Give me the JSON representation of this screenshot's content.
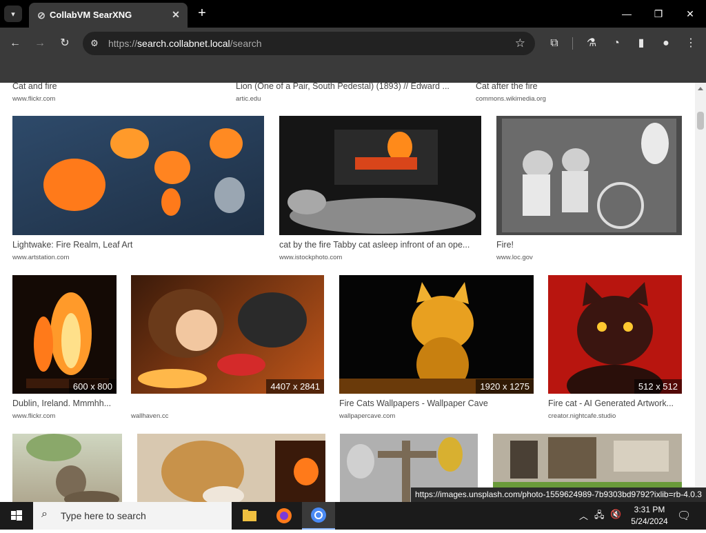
{
  "browser": {
    "tab_title": "CollabVM SearXNG",
    "url_scheme": "https://",
    "url_host": "search.collabnet.local",
    "url_path": "/search",
    "status_url": "https://images.unsplash.com/photo-1559624989-7b9303bd9792?ixlib=rb-4.0.3"
  },
  "results": [
    {
      "title": "Cat and fire",
      "source": "www.flickr.com"
    },
    {
      "title": "Lion (One of a Pair, South Pedestal) (1893) // Edward ...",
      "source": "artic.edu"
    },
    {
      "title": "Cat after the fire",
      "source": "commons.wikimedia.org"
    },
    {
      "title": "Lightwake: Fire Realm, Leaf Art",
      "source": "www.artstation.com"
    },
    {
      "title": "cat by the fire Tabby cat asleep infront of an ope...",
      "source": "www.istockphoto.com"
    },
    {
      "title": "Fire!",
      "source": "www.loc.gov"
    },
    {
      "title": "Dublin, Ireland. Mmmhh...",
      "source": "www.flickr.com",
      "dimensions": "600 x 800"
    },
    {
      "title": "",
      "source": "wallhaven.cc",
      "dimensions": "4407 x 2841"
    },
    {
      "title": "Fire Cats Wallpapers - Wallpaper Cave",
      "source": "wallpapercave.com",
      "dimensions": "1920 x 1275"
    },
    {
      "title": "Fire cat - AI Generated Artwork...",
      "source": "creator.nightcafe.studio",
      "dimensions": "512 x 512"
    }
  ],
  "taskbar": {
    "search_placeholder": "Type here to search",
    "time": "3:31 PM",
    "date": "5/24/2024"
  },
  "colors": {
    "browser_dark": "#3a3a3a",
    "taskbar": "#1b1b1b",
    "link_accent": "#8ab4f8"
  }
}
